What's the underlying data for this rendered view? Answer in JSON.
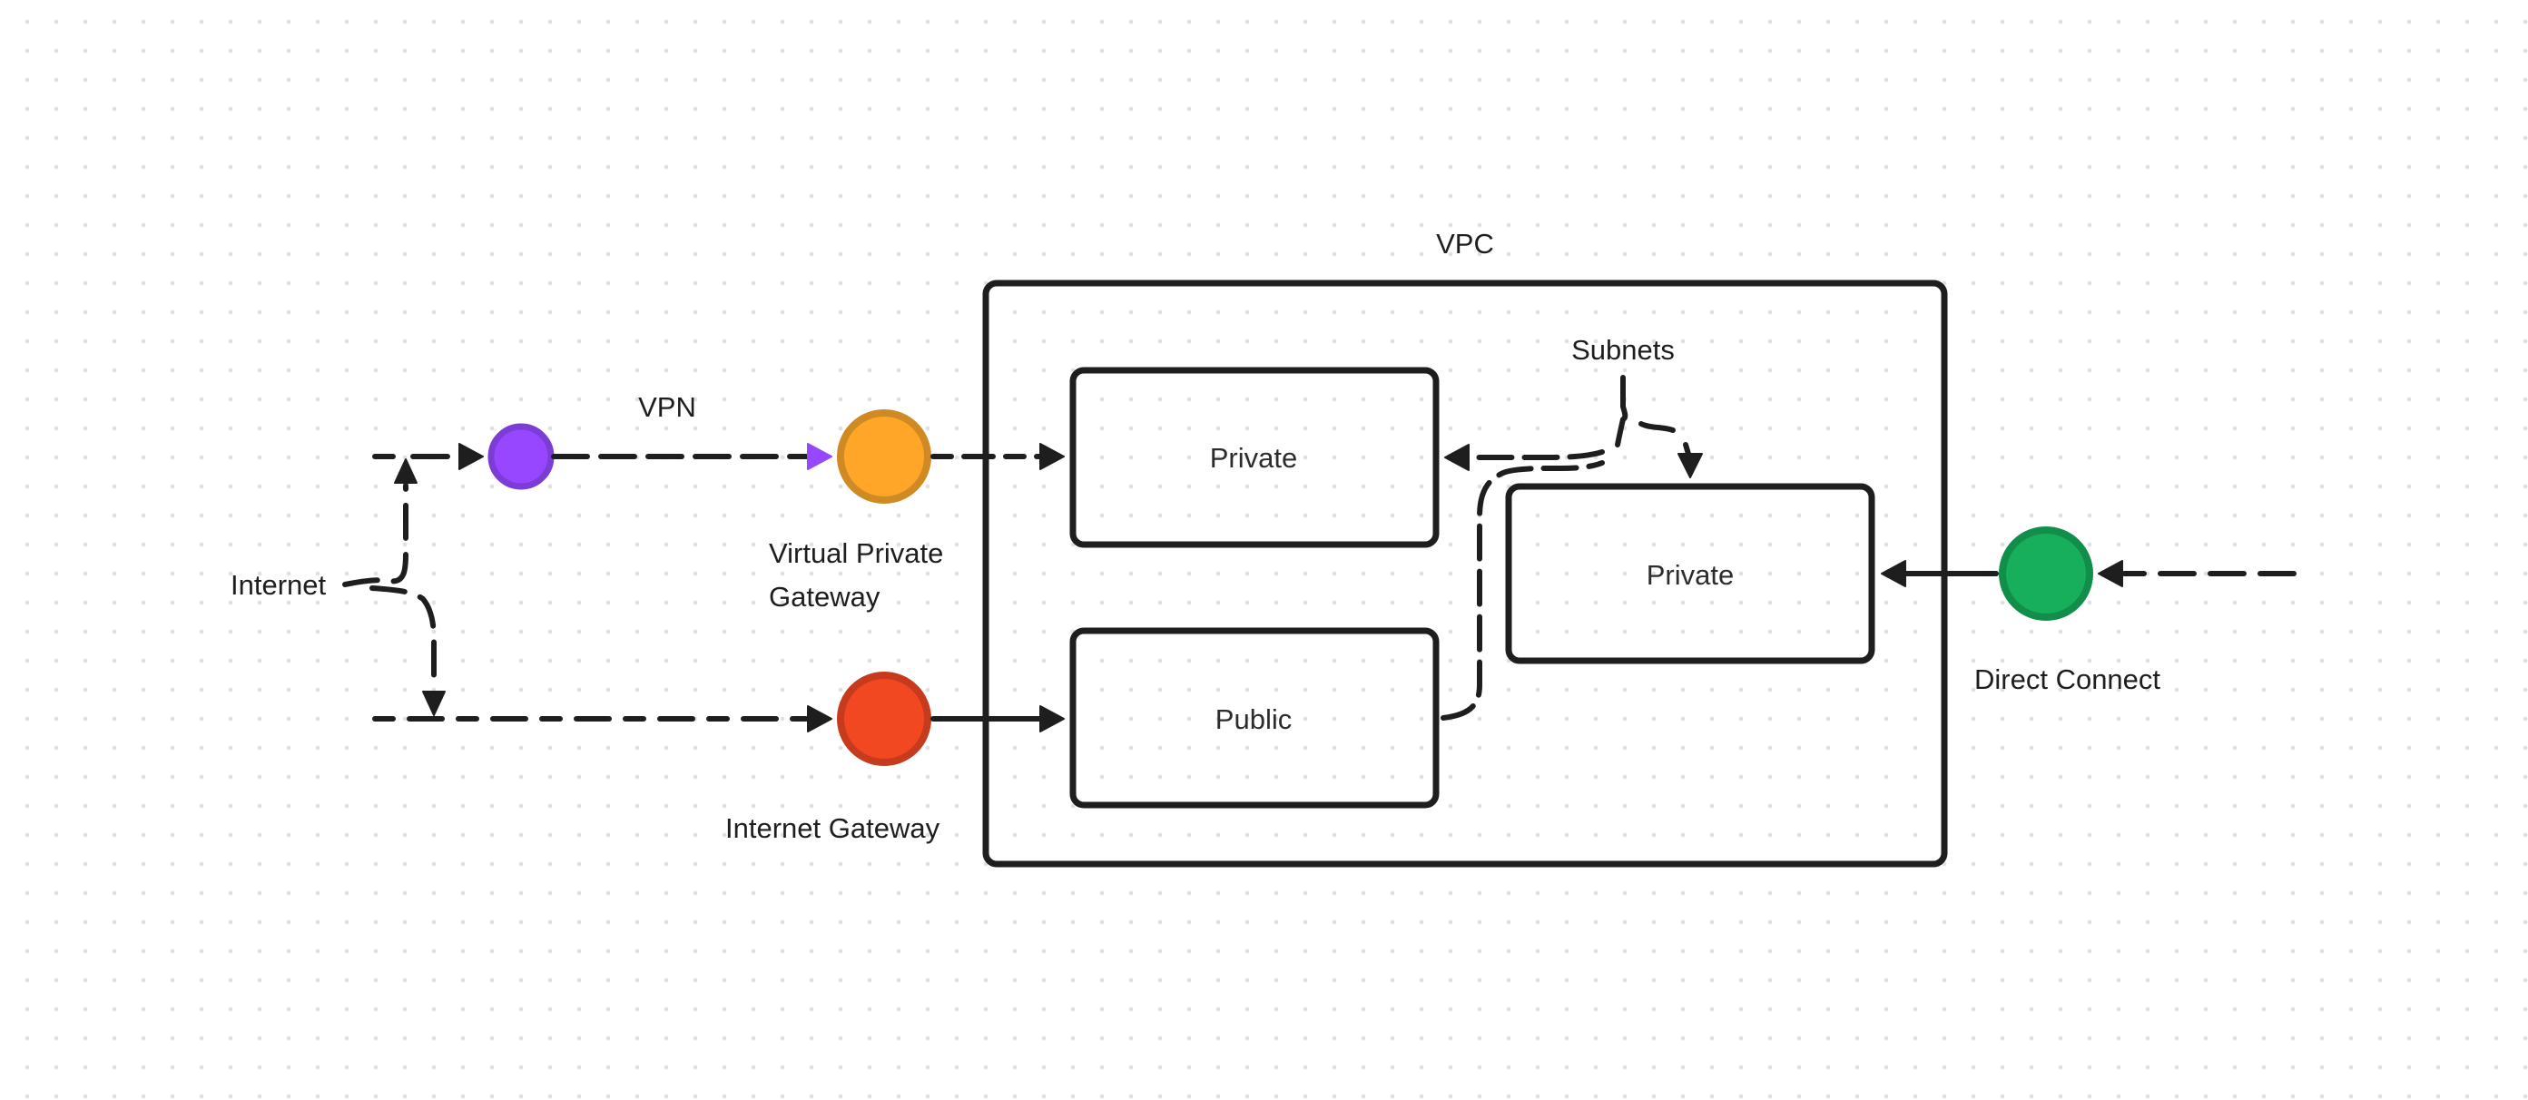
{
  "diagram": {
    "title": "VPC",
    "nodes": {
      "internet": {
        "label": "Internet"
      },
      "vpn_client": {
        "label": "",
        "fill": "#9747FF",
        "stroke": "#7B3DD6"
      },
      "vpn": {
        "label": "VPN"
      },
      "virtual_private_gateway": {
        "label_line1": "Virtual Private",
        "label_line2": "Gateway",
        "fill": "#FFA629",
        "stroke": "#D08A24"
      },
      "internet_gateway": {
        "label": "Internet Gateway",
        "fill": "#F24822",
        "stroke": "#C63A1E"
      },
      "direct_connect": {
        "label": "Direct Connect",
        "fill": "#17AE5C",
        "stroke": "#128E4B"
      },
      "vpc": {
        "label": "VPC"
      },
      "subnets": {
        "label": "Subnets"
      },
      "private_subnet_1": {
        "label": "Private"
      },
      "public_subnet": {
        "label": "Public"
      },
      "private_subnet_2": {
        "label": "Private"
      }
    },
    "edges": [
      {
        "from": "internet",
        "to": "vpn_client",
        "style": "dashed"
      },
      {
        "from": "internet",
        "to": "internet_gateway",
        "style": "dashed"
      },
      {
        "from": "vpn_client",
        "to": "virtual_private_gateway",
        "style": "dashed",
        "color": "#9747FF",
        "label": "VPN"
      },
      {
        "from": "virtual_private_gateway",
        "to": "private_subnet_1",
        "style": "dashed"
      },
      {
        "from": "internet_gateway",
        "to": "public_subnet",
        "style": "solid"
      },
      {
        "from": "subnets",
        "to": "private_subnet_1",
        "style": "dashed"
      },
      {
        "from": "subnets",
        "to": "private_subnet_2",
        "style": "dashed"
      },
      {
        "from": "public_subnet",
        "to": "subnets",
        "style": "dashed"
      },
      {
        "from": "direct_connect",
        "to": "private_subnet_2",
        "style": "solid"
      },
      {
        "from": "external",
        "to": "direct_connect",
        "style": "dashed"
      }
    ]
  }
}
